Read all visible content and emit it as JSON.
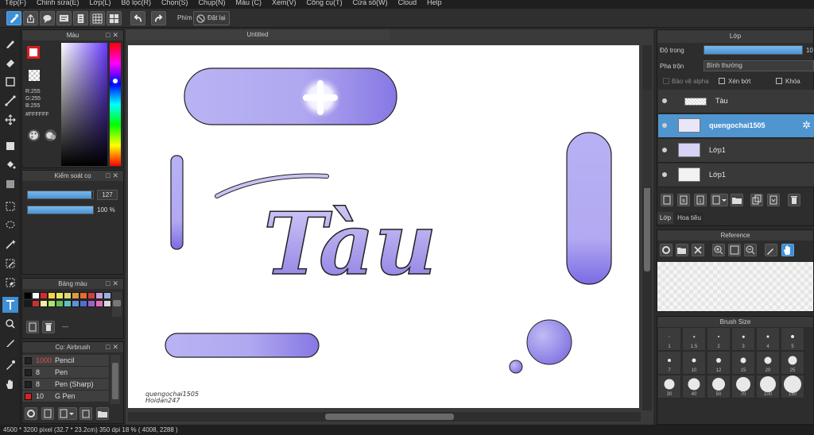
{
  "menu": [
    "Tệp(F)",
    "Chỉnh sửa(E)",
    "Lớp(L)",
    "Bộ lọc(R)",
    "Chọn(S)",
    "Chụp(N)",
    "Màu (C)",
    "Xem(V)",
    "Công cụ(T)",
    "Cửa sổ(W)",
    "Cloud",
    "Help"
  ],
  "toolbar": {
    "keys_label": "Phím",
    "reset_label": "Đặt lại"
  },
  "color_panel": {
    "title": "Màu",
    "r": "R:255",
    "g": "G:255",
    "b": "B:255",
    "hex": "#FFFFFF",
    "foreground": "#d81f1f"
  },
  "brush_control": {
    "title": "Kiểm soát cọ",
    "size_value": "127",
    "opacity_value": "100 %",
    "size_fraction": 0.97,
    "opacity_fraction": 1.0
  },
  "swatch_panel": {
    "title": "Bảng màu",
    "dash": "---",
    "colors": [
      "#000000",
      "#ffffff",
      "#d62b2b",
      "#f2d64a",
      "#e8e85e",
      "#d9d97a",
      "#e09a3a",
      "#e86a2b",
      "#d04040",
      "#c8a0d8",
      "#9ab0e0",
      "#1a1a1a",
      "#c83232",
      "#f0f0a0",
      "#b0e070",
      "#60c060",
      "#60c0c0",
      "#6090e0",
      "#5070d0",
      "#a060c0",
      "#e070b0",
      "#d9d9d9"
    ]
  },
  "brush_panel": {
    "title": "Cọ: Airbrush",
    "items": [
      {
        "size": "1000",
        "name": "Pencil",
        "swatch": "#222222"
      },
      {
        "size": "8",
        "name": "Pen",
        "swatch": "#222222"
      },
      {
        "size": "8",
        "name": "Pen (Sharp)",
        "swatch": "#222222"
      },
      {
        "size": "10",
        "name": "G Pen",
        "swatch": "#e02020"
      }
    ]
  },
  "document": {
    "tab": "Untitled",
    "main_text": "Tàu",
    "watermark_line1": "quengochai1505",
    "watermark_line2": "Hoidan247"
  },
  "status": {
    "text": "4500 * 3200 pixel  (32.7 * 23.2cm)  350 dpi  18 %  ( 4008, 2288 )"
  },
  "layers_panel": {
    "title": "Lớp",
    "opacity_label": "Độ trong",
    "opacity_value": "10",
    "blend_label": "Pha trộn",
    "blend_value": "Bình thường",
    "protect_alpha": "Bảo vệ alpha",
    "clip": "Xén bớt",
    "lock": "Khóa",
    "layers": [
      {
        "name": "Tàu",
        "selected": false
      },
      {
        "name": "quengochai1505",
        "selected": true
      },
      {
        "name": "Lớp1",
        "selected": false
      },
      {
        "name": "Lớp1",
        "selected": false
      }
    ],
    "tab_layer": "Lớp",
    "tab_navigator": "Hoa tiêu"
  },
  "reference_panel": {
    "title": "Reference"
  },
  "brush_size_panel": {
    "title": "Brush Size",
    "sizes": [
      "1",
      "1.5",
      "2",
      "3",
      "4",
      "5",
      "7",
      "10",
      "12",
      "15",
      "20",
      "25",
      "30",
      "40",
      "50",
      "70",
      "100",
      "150"
    ]
  }
}
